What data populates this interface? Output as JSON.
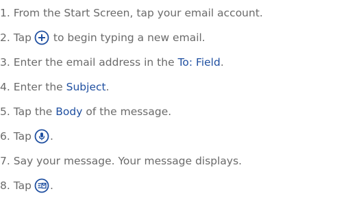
{
  "steps": [
    {
      "number": "1.",
      "text": "From the Start Screen, tap your email account."
    },
    {
      "number": "2.",
      "before": "Tap",
      "icon": "plus-circle-icon",
      "after": "to begin typing a new email."
    },
    {
      "number": "3.",
      "before": "Enter the email address in the",
      "highlight": "To: Field",
      "after": "."
    },
    {
      "number": "4.",
      "before": "Enter the",
      "highlight": "Subject",
      "after": "."
    },
    {
      "number": "5.",
      "before": "Tap the",
      "highlight": "Body",
      "after": "of the message."
    },
    {
      "number": "6.",
      "before": "Tap",
      "icon": "microphone-icon",
      "after": "."
    },
    {
      "number": "7.",
      "text": "Say your message. Your message displays."
    },
    {
      "number": "8.",
      "before": "Tap",
      "icon": "send-icon",
      "after": "."
    }
  ],
  "colors": {
    "text": "#6a6a6a",
    "highlight": "#1f4fa0"
  }
}
